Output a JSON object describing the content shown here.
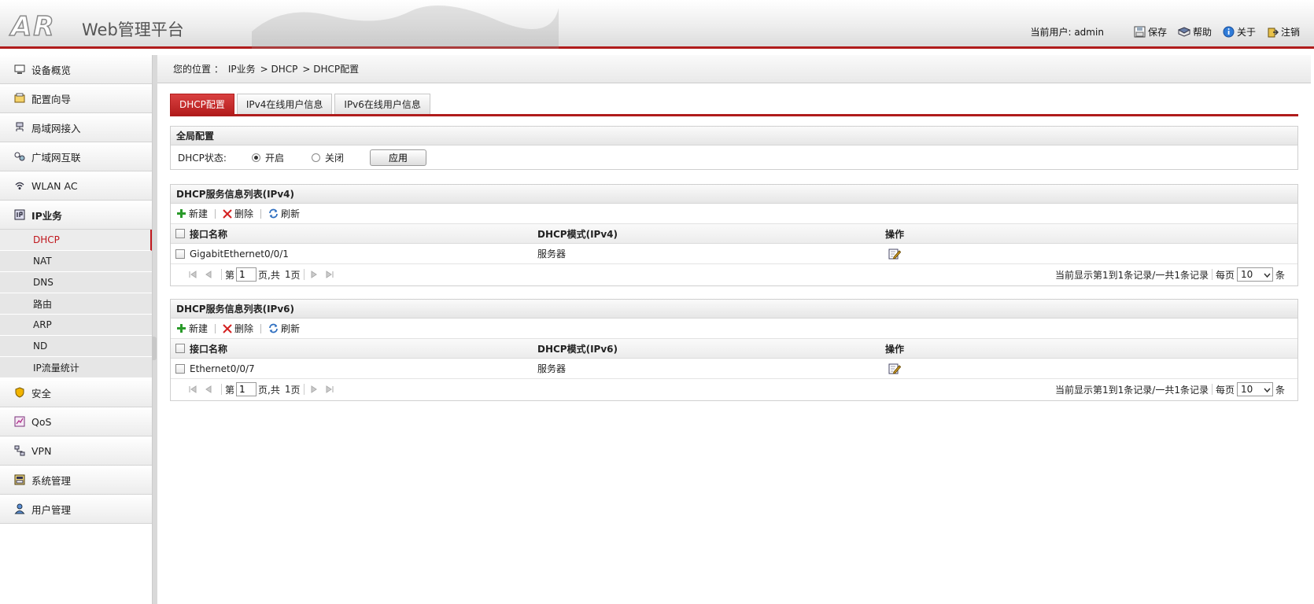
{
  "header": {
    "logo": "AR",
    "title": "Web管理平台",
    "current_user": "当前用户: admin",
    "save": "保存",
    "help": "帮助",
    "about": "关于",
    "logout": "注销"
  },
  "sidebar": {
    "items": [
      {
        "label": "设备概览"
      },
      {
        "label": "配置向导"
      },
      {
        "label": "局域网接入"
      },
      {
        "label": "广域网互联"
      },
      {
        "label": "WLAN AC"
      },
      {
        "label": "IP业务"
      }
    ],
    "sub_items": [
      {
        "label": "DHCP"
      },
      {
        "label": "NAT"
      },
      {
        "label": "DNS"
      },
      {
        "label": "路由"
      },
      {
        "label": "ARP"
      },
      {
        "label": "ND"
      },
      {
        "label": "IP流量统计"
      }
    ],
    "items_after": [
      {
        "label": "安全"
      },
      {
        "label": "QoS"
      },
      {
        "label": "VPN"
      },
      {
        "label": "系统管理"
      },
      {
        "label": "用户管理"
      }
    ]
  },
  "breadcrumb": {
    "prefix": "您的位置 ：",
    "path": [
      "IP业务",
      "> DHCP",
      "> DHCP配置"
    ]
  },
  "tabs": [
    {
      "label": "DHCP配置",
      "active": true
    },
    {
      "label": "IPv4在线用户信息"
    },
    {
      "label": "IPv6在线用户信息"
    }
  ],
  "global_config": {
    "title": "全局配置",
    "status_label": "DHCP状态:",
    "option_on": "开启",
    "option_off": "关闭",
    "selected": "on",
    "apply": "应用"
  },
  "ipv4_list": {
    "title": "DHCP服务信息列表(IPv4)",
    "toolbar": {
      "new": "新建",
      "delete": "删除",
      "refresh": "刷新"
    },
    "columns": [
      "接口名称",
      "DHCP模式(IPv4)",
      "操作"
    ],
    "rows": [
      {
        "interface": "GigabitEthernet0/0/1",
        "mode": "服务器"
      }
    ],
    "pager": {
      "page_prefix": "第",
      "page": "1",
      "page_suffix": "页,共",
      "total_pages": "1",
      "pages_suffix": "页",
      "summary": "当前显示第1到1条记录/一共1条记录",
      "per_page_label": "每页",
      "per_page": "10",
      "per_page_unit": "条"
    }
  },
  "ipv6_list": {
    "title": "DHCP服务信息列表(IPv6)",
    "toolbar": {
      "new": "新建",
      "delete": "删除",
      "refresh": "刷新"
    },
    "columns": [
      "接口名称",
      "DHCP模式(IPv6)",
      "操作"
    ],
    "rows": [
      {
        "interface": "Ethernet0/0/7",
        "mode": "服务器"
      }
    ],
    "pager": {
      "page_prefix": "第",
      "page": "1",
      "page_suffix": "页,共",
      "total_pages": "1",
      "pages_suffix": "页",
      "summary": "当前显示第1到1条记录/一共1条记录",
      "per_page_label": "每页",
      "per_page": "10",
      "per_page_unit": "条"
    }
  },
  "colors": {
    "brand_red": "#b01c1c",
    "active_text": "#c0161c"
  }
}
